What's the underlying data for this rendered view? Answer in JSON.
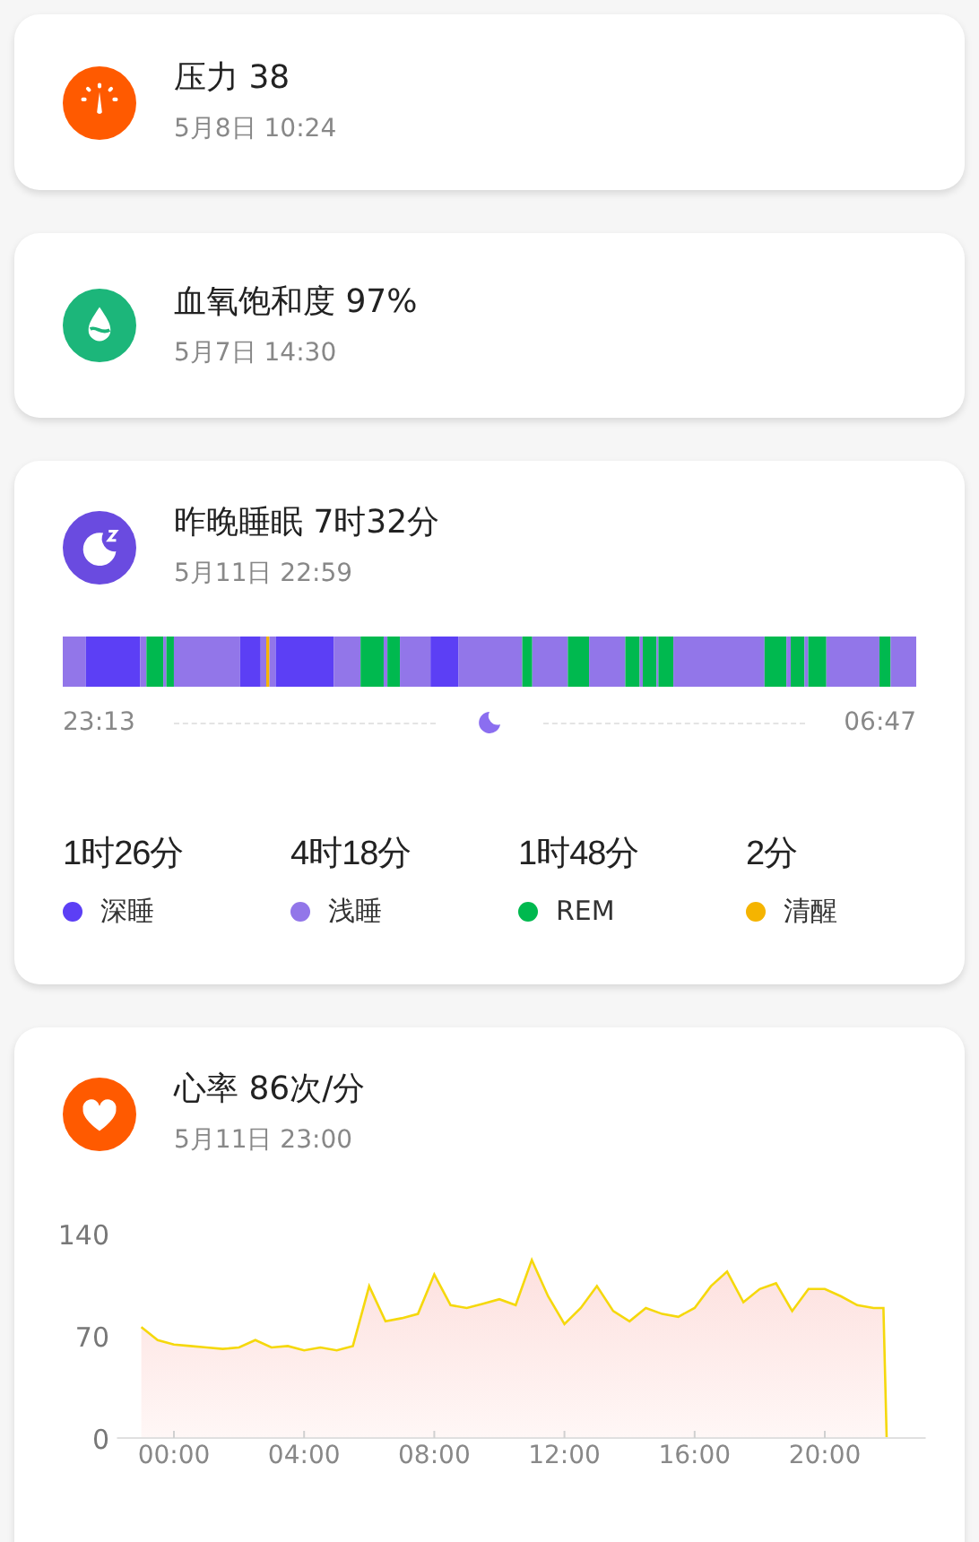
{
  "cards": [
    {
      "kind": "stress",
      "title": "压力 38",
      "date": "5月8日 10:24"
    },
    {
      "kind": "oxygen",
      "title": "血氧饱和度 97%",
      "date": "5月7日 14:30"
    }
  ],
  "sleep": {
    "title": "昨晚睡眠 7时32分",
    "date": "5月11日 22:59",
    "start": "23:13",
    "end": "06:47",
    "stages": [
      {
        "duration": "1时26分",
        "label": "深睡",
        "color": "#5c3ff5"
      },
      {
        "duration": "4时18分",
        "label": "浅睡",
        "color": "#9276e9"
      },
      {
        "duration": "1时48分",
        "label": "REM",
        "color": "#00b94f"
      },
      {
        "duration": "2分",
        "label": "清醒",
        "color": "#f5b400"
      }
    ]
  },
  "heart": {
    "title": "心率 86次/分",
    "date": "5月11日 23:00",
    "chart_data": {
      "type": "area",
      "x": [
        -1,
        -0.5,
        0,
        0.5,
        1,
        1.5,
        2,
        2.5,
        3,
        3.5,
        4,
        4.5,
        5,
        5.5,
        6,
        6.5,
        7,
        7.5,
        8,
        8.5,
        9,
        9.5,
        10,
        10.5,
        11,
        11.5,
        12,
        12.5,
        13,
        13.5,
        14,
        14.5,
        15,
        15.5,
        16,
        16.5,
        17,
        17.5,
        18,
        18.5,
        19,
        19.5,
        20,
        20.5,
        21,
        21.5,
        21.8,
        21.9
      ],
      "series": [
        {
          "color": "#f5d80c",
          "values": [
            76,
            67,
            64,
            63,
            62,
            61,
            62,
            67,
            62,
            63,
            60,
            62,
            60,
            63,
            104,
            80,
            82,
            85,
            112,
            91,
            89,
            92,
            95,
            91,
            122,
            97,
            78,
            89,
            104,
            87,
            80,
            89,
            85,
            83,
            89,
            104,
            114,
            93,
            102,
            106,
            87,
            102,
            102,
            97,
            91,
            89,
            89,
            0
          ]
        }
      ],
      "xlim": [
        -1.75,
        23.1
      ],
      "ylim": [
        0,
        140
      ],
      "yticks": [
        0,
        70,
        140
      ],
      "xticks": [
        {
          "value": 0,
          "label": "00:00"
        },
        {
          "value": 4,
          "label": "04:00"
        },
        {
          "value": 8,
          "label": "08:00"
        },
        {
          "value": 12,
          "label": "12:00"
        },
        {
          "value": 16,
          "label": "16:00"
        },
        {
          "value": 20,
          "label": "20:00"
        }
      ]
    }
  }
}
